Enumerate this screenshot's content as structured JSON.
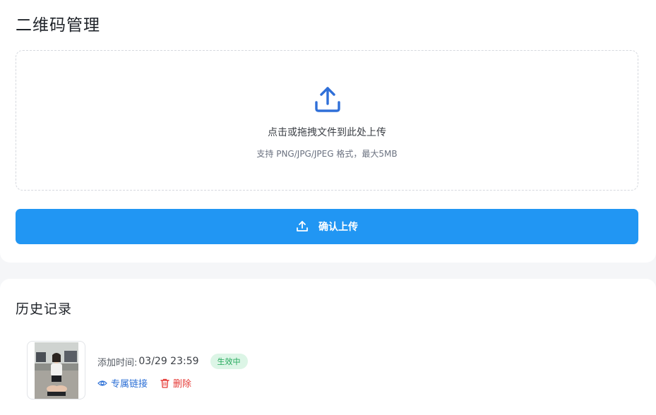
{
  "upload": {
    "title": "二维码管理",
    "dropzone": {
      "icon": "upload-icon",
      "hint_main": "点击或拖拽文件到此处上传",
      "hint_sub": "支持 PNG/JPG/JPEG 格式，最大5MB"
    },
    "confirm_button": {
      "icon": "upload-icon",
      "label": "确认上传"
    }
  },
  "history": {
    "title": "历史记录",
    "items": [
      {
        "added_label": "添加时间:",
        "added_time": "03/29 23:59",
        "status": "生效中",
        "link_label": "专属链接",
        "delete_label": "删除"
      }
    ]
  },
  "colors": {
    "primary": "#2196f3",
    "icon_blue": "#2f6fd8",
    "status_bg": "#dcf5e6",
    "status_text": "#22a85a",
    "danger": "#e53935"
  }
}
